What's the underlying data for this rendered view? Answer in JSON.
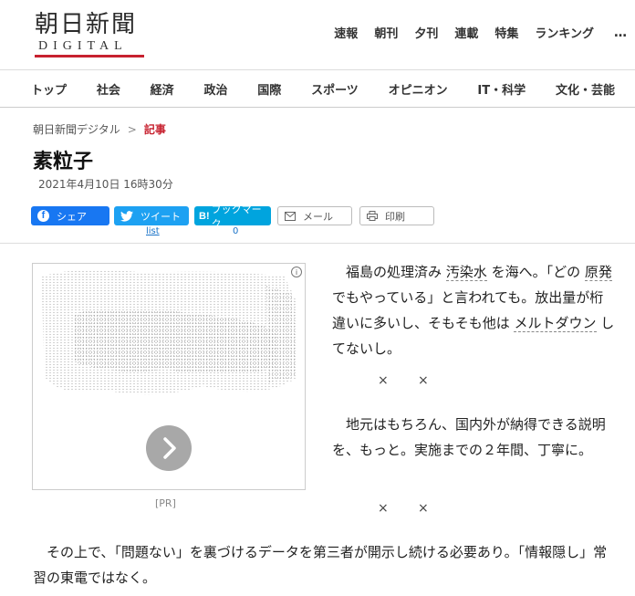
{
  "header": {
    "logo_title": "朝日新聞",
    "logo_sub": "DIGITAL",
    "top_nav": [
      "速報",
      "朝刊",
      "夕刊",
      "連載",
      "特集",
      "ランキング"
    ],
    "more": "…"
  },
  "categories": [
    "トップ",
    "社会",
    "経済",
    "政治",
    "国際",
    "スポーツ",
    "オピニオン",
    "IT・科学",
    "文化・芸能"
  ],
  "breadcrumb": {
    "home": "朝日新聞デジタル",
    "sep": ">",
    "current": "記事"
  },
  "article": {
    "title": "素粒子",
    "date": "2021年4月10日 16時30分",
    "p1_a": "　福島の処理済み ",
    "p1_kw1": "汚染水",
    "p1_b": " を海へ。「どの ",
    "p1_kw2": "原発",
    "p1_c": " でもやっている」と言われても。放出量が桁違いに多いし、そもそも他は ",
    "p1_kw3": "メルトダウン",
    "p1_d": " してないし。",
    "cross": "×",
    "p2": "　地元はもちろん、国内外が納得できる説明を、もっと。実施までの２年間、丁寧に。",
    "p3": "　その上で、「問題ない」を裏づけるデータを第三者が開示し続ける必要あり。「情報隠し」常習の東電ではなく。"
  },
  "share": {
    "facebook": "シェア",
    "facebook_icon": "f",
    "twitter": "ツイート",
    "twitter_count": "list",
    "hatena": "ブックマーク",
    "hatena_icon": "B!",
    "hatena_count": "0",
    "mail": "メール",
    "print": "印刷"
  },
  "ad": {
    "label": "[PR]",
    "info_icon": "i"
  },
  "colors": {
    "brand_red": "#c7212f",
    "facebook": "#1877f2",
    "twitter": "#1da1f2",
    "hatena": "#00a4de"
  }
}
